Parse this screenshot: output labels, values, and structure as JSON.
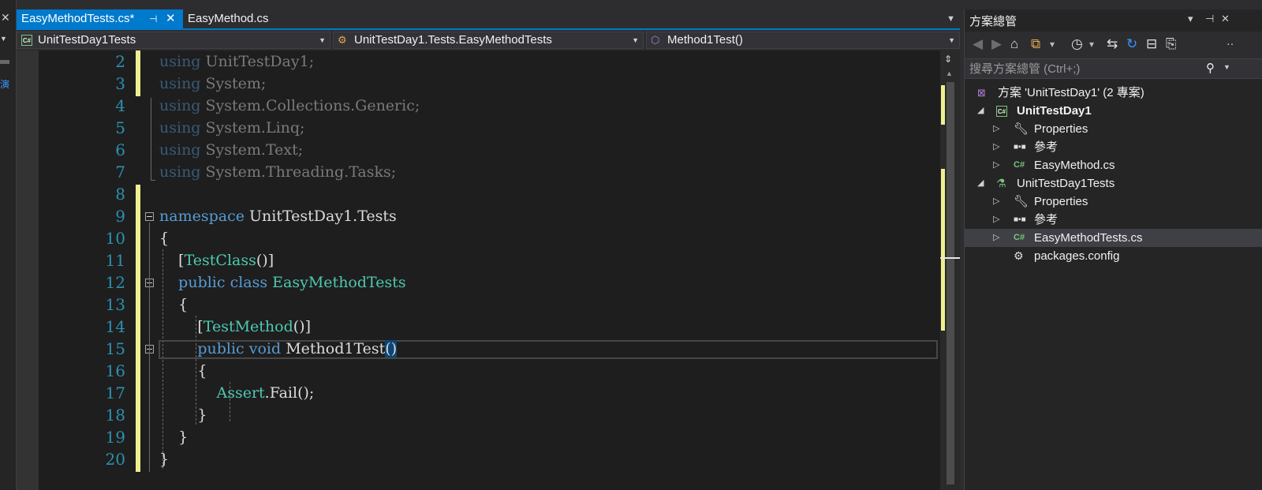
{
  "tabs": {
    "active": {
      "label": "EasyMethodTests.cs*",
      "pin": "⊣",
      "close": "✕"
    },
    "second": {
      "label": "EasyMethod.cs"
    },
    "overflow": "▼"
  },
  "nav": {
    "project": "UnitTestDay1Tests",
    "class": "UnitTestDay1.Tests.EasyMethodTests",
    "member": "Method1Test()"
  },
  "left_strip": {
    "close": "✕",
    "dropdown": "▼",
    "fragment": "演"
  },
  "code": {
    "line_numbers": [
      "2",
      "3",
      "4",
      "5",
      "6",
      "7",
      "8",
      "9",
      "10",
      "11",
      "12",
      "13",
      "14",
      "15",
      "16",
      "17",
      "18",
      "19",
      "20"
    ],
    "t_using": "using",
    "ns1": "UnitTestDay1;",
    "ns2": "System;",
    "ns3": "System.Collections.Generic;",
    "ns4": "System.Linq;",
    "ns5": "System.Text;",
    "ns6": "System.Threading.Tasks;",
    "t_namespace": "namespace",
    "namespace_name": "UnitTestDay1.Tests",
    "brace_open": "{",
    "brace_close": "}",
    "bracket_open": "[",
    "bracket_close": "()]",
    "attr_class": "TestClass",
    "attr_method": "TestMethod",
    "t_public": "public",
    "t_class": "class",
    "class_name": "EasyMethodTests",
    "t_void": "void",
    "method_name": "Method1Test",
    "method_parens": "()",
    "assert_type": "Assert",
    "assert_call": ".Fail();"
  },
  "solution_explorer": {
    "title": "方案總管",
    "title_buttons": [
      "▾",
      "⊣",
      "✕"
    ],
    "more": "‥",
    "search_placeholder": "搜尋方案總管 (Ctrl+;)",
    "search_icon": "⚲",
    "search_dropdown": "▼",
    "toolbar": [
      "◀",
      "▶",
      "⌂",
      "⧉",
      "▾",
      "◷",
      "▾",
      "⇆",
      "↻",
      "⊟",
      "⎘"
    ],
    "tree": [
      {
        "label": "方案 'UnitTestDay1' (2 專案)",
        "icon": "solution-icon",
        "expander": ""
      },
      {
        "label": "UnitTestDay1",
        "icon": "csharp-project-icon",
        "expander": "◢"
      },
      {
        "label": "Properties",
        "icon": "wrench-icon",
        "expander": "▷"
      },
      {
        "label": "參考",
        "icon": "references-icon",
        "expander": "▷"
      },
      {
        "label": "EasyMethod.cs",
        "icon": "csharp-file-icon",
        "expander": "▷"
      },
      {
        "label": "UnitTestDay1Tests",
        "icon": "test-project-icon",
        "expander": "◢"
      },
      {
        "label": "Properties",
        "icon": "wrench-icon",
        "expander": "▷"
      },
      {
        "label": "參考",
        "icon": "references-icon",
        "expander": "▷"
      },
      {
        "label": "EasyMethodTests.cs",
        "icon": "csharp-file-icon",
        "expander": "▷"
      },
      {
        "label": "packages.config",
        "icon": "config-file-icon",
        "expander": ""
      }
    ]
  },
  "colors": {
    "accent": "#007acc",
    "keyword": "#569cd6",
    "type": "#4ec9b0",
    "line_number": "#2b91af",
    "change_marker": "#efef91"
  }
}
